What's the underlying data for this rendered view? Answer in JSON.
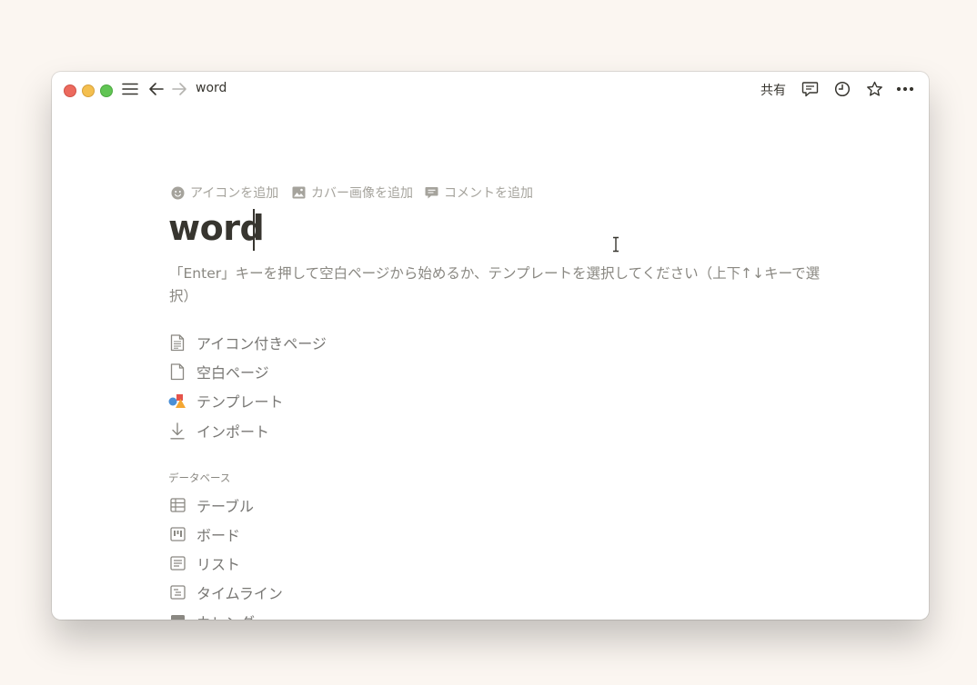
{
  "titlebar": {
    "page_title": "word",
    "share_label": "共有"
  },
  "page_actions": {
    "add_icon": "アイコンを追加",
    "add_cover": "カバー画像を追加",
    "add_comment": "コメントを追加"
  },
  "page": {
    "title": "word",
    "hint": "「Enter」キーを押して空白ページから始めるか、テンプレートを選択してください（上下↑↓キーで選択）"
  },
  "menu": {
    "items": [
      {
        "label": "アイコン付きページ",
        "icon": "document-lines-icon"
      },
      {
        "label": "空白ページ",
        "icon": "document-icon"
      },
      {
        "label": "テンプレート",
        "icon": "shapes-icon"
      },
      {
        "label": "インポート",
        "icon": "download-arrow-icon"
      }
    ]
  },
  "database": {
    "section_label": "データベース",
    "items": [
      {
        "label": "テーブル",
        "icon": "table-icon"
      },
      {
        "label": "ボード",
        "icon": "board-icon"
      },
      {
        "label": "リスト",
        "icon": "list-icon"
      },
      {
        "label": "タイムライン",
        "icon": "timeline-icon"
      },
      {
        "label": "カレンダー",
        "icon": "calendar-icon"
      }
    ]
  },
  "colors": {
    "text": "#37352f",
    "muted": "#787774",
    "placeholder": "#a5a39c",
    "background": "#fbf6f1"
  }
}
